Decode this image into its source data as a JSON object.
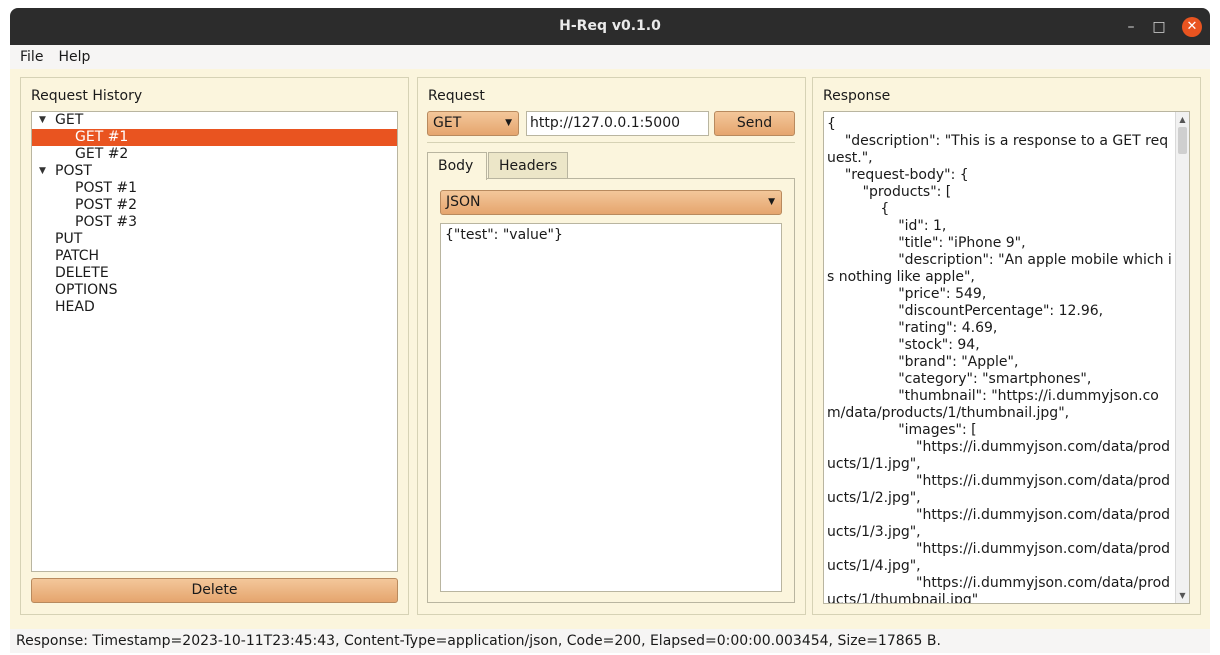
{
  "window": {
    "title": "H-Req v0.1.0"
  },
  "titlebar": {
    "minimize": "–",
    "maximize": "□",
    "close": "✕"
  },
  "menu": [
    "File",
    "Help"
  ],
  "history": {
    "title": "Request History",
    "tree": [
      {
        "label": "GET",
        "kind": "cat",
        "expanded": true
      },
      {
        "label": "GET #1",
        "kind": "child",
        "selected": true
      },
      {
        "label": "GET #2",
        "kind": "child"
      },
      {
        "label": "POST",
        "kind": "cat",
        "expanded": true
      },
      {
        "label": "POST #1",
        "kind": "child"
      },
      {
        "label": "POST #2",
        "kind": "child"
      },
      {
        "label": "POST #3",
        "kind": "child"
      },
      {
        "label": "PUT",
        "kind": "cat"
      },
      {
        "label": "PATCH",
        "kind": "cat"
      },
      {
        "label": "DELETE",
        "kind": "cat"
      },
      {
        "label": "OPTIONS",
        "kind": "cat"
      },
      {
        "label": "HEAD",
        "kind": "cat"
      }
    ],
    "delete_label": "Delete"
  },
  "request": {
    "title": "Request",
    "method": "GET",
    "url": "http://127.0.0.1:5000",
    "send_label": "Send",
    "tabs": [
      "Body",
      "Headers"
    ],
    "body_type": "JSON",
    "body": "{\"test\": \"value\"}"
  },
  "response": {
    "title": "Response",
    "text": "{\n    \"description\": \"This is a response to a GET request.\",\n    \"request-body\": {\n        \"products\": [\n            {\n                \"id\": 1,\n                \"title\": \"iPhone 9\",\n                \"description\": \"An apple mobile which is nothing like apple\",\n                \"price\": 549,\n                \"discountPercentage\": 12.96,\n                \"rating\": 4.69,\n                \"stock\": 94,\n                \"brand\": \"Apple\",\n                \"category\": \"smartphones\",\n                \"thumbnail\": \"https://i.dummyjson.com/data/products/1/thumbnail.jpg\",\n                \"images\": [\n                    \"https://i.dummyjson.com/data/products/1/1.jpg\",\n                    \"https://i.dummyjson.com/data/products/1/2.jpg\",\n                    \"https://i.dummyjson.com/data/products/1/3.jpg\",\n                    \"https://i.dummyjson.com/data/products/1/4.jpg\",\n                    \"https://i.dummyjson.com/data/products/1/thumbnail.jpg\""
  },
  "status": "Response: Timestamp=2023-10-11T23:45:43, Content-Type=application/json, Code=200, Elapsed=0:00:00.003454, Size=17865 B.",
  "colors": {
    "accent": "#e95420",
    "panel": "#fbf5dd",
    "button": "#e5a56e",
    "titlebar": "#2c2c2c"
  }
}
